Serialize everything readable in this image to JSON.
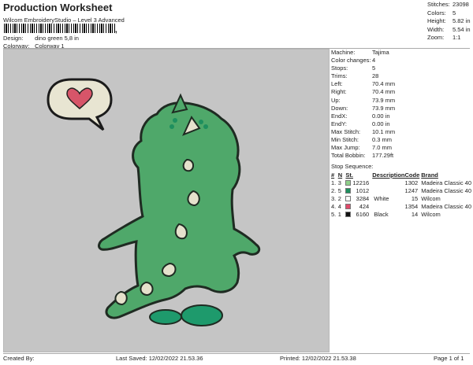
{
  "header": {
    "title": "Production Worksheet",
    "subtitle": "Wilcom EmbroideryStudio – Level 3 Advanced",
    "barcode_tail": ","
  },
  "meta": {
    "design_label": "Design:",
    "design_value": "dino green 5,8 in",
    "colorway_label": "Colorway:",
    "colorway_value": "Colorway 1"
  },
  "summary": [
    {
      "label": "Stitches:",
      "value": "23098"
    },
    {
      "label": "Colors:",
      "value": "5"
    },
    {
      "label": "Height:",
      "value": "5.82 in"
    },
    {
      "label": "Width:",
      "value": "5.54 in"
    },
    {
      "label": "Zoom:",
      "value": "1:1"
    }
  ],
  "machine_info": [
    {
      "label": "Machine:",
      "value": "Tajima"
    },
    {
      "label": "Color changes:",
      "value": "4"
    },
    {
      "label": "Stops:",
      "value": "5"
    },
    {
      "label": "Trims:",
      "value": "28"
    },
    {
      "label": "Left:",
      "value": "70.4 mm"
    },
    {
      "label": "Right:",
      "value": "70.4 mm"
    },
    {
      "label": "Up:",
      "value": "73.9 mm"
    },
    {
      "label": "Down:",
      "value": "73.9 mm"
    },
    {
      "label": "EndX:",
      "value": "0.00 in"
    },
    {
      "label": "EndY:",
      "value": "0.00 in"
    },
    {
      "label": "Max Stitch:",
      "value": "10.1 mm"
    },
    {
      "label": "Min Stitch:",
      "value": "0.3 mm"
    },
    {
      "label": "Max Jump:",
      "value": "7.0 mm"
    },
    {
      "label": "Total Bobbin:",
      "value": "177.29ft"
    }
  ],
  "stop_sequence": {
    "title": "Stop Sequence:",
    "headers": [
      "#",
      "N",
      "St.",
      "Description",
      "Code",
      "Brand"
    ],
    "rows": [
      {
        "num": "1.",
        "n": "3",
        "color": "#8fd08a",
        "st": "12216",
        "desc": "",
        "code": "1302",
        "brand": "Madeira Classic 40"
      },
      {
        "num": "2.",
        "n": "5",
        "color": "#1e8f5e",
        "st": "1012",
        "desc": "",
        "code": "1247",
        "brand": "Madeira Classic 40"
      },
      {
        "num": "3.",
        "n": "2",
        "color": "#ffffff",
        "st": "3284",
        "desc": "White",
        "code": "15",
        "brand": "Wilcom"
      },
      {
        "num": "4.",
        "n": "4",
        "color": "#e04a6a",
        "st": "424",
        "desc": "",
        "code": "1354",
        "brand": "Madeira Classic 40"
      },
      {
        "num": "5.",
        "n": "1",
        "color": "#111111",
        "st": "6160",
        "desc": "Black",
        "code": "14",
        "brand": "Wilcom"
      }
    ]
  },
  "footer": {
    "created_by": "Created By:",
    "last_saved": "Last Saved: 12/02/2022 21.53.36",
    "printed": "Printed: 12/02/2022 21.53.38",
    "page": "Page 1 of 1"
  }
}
